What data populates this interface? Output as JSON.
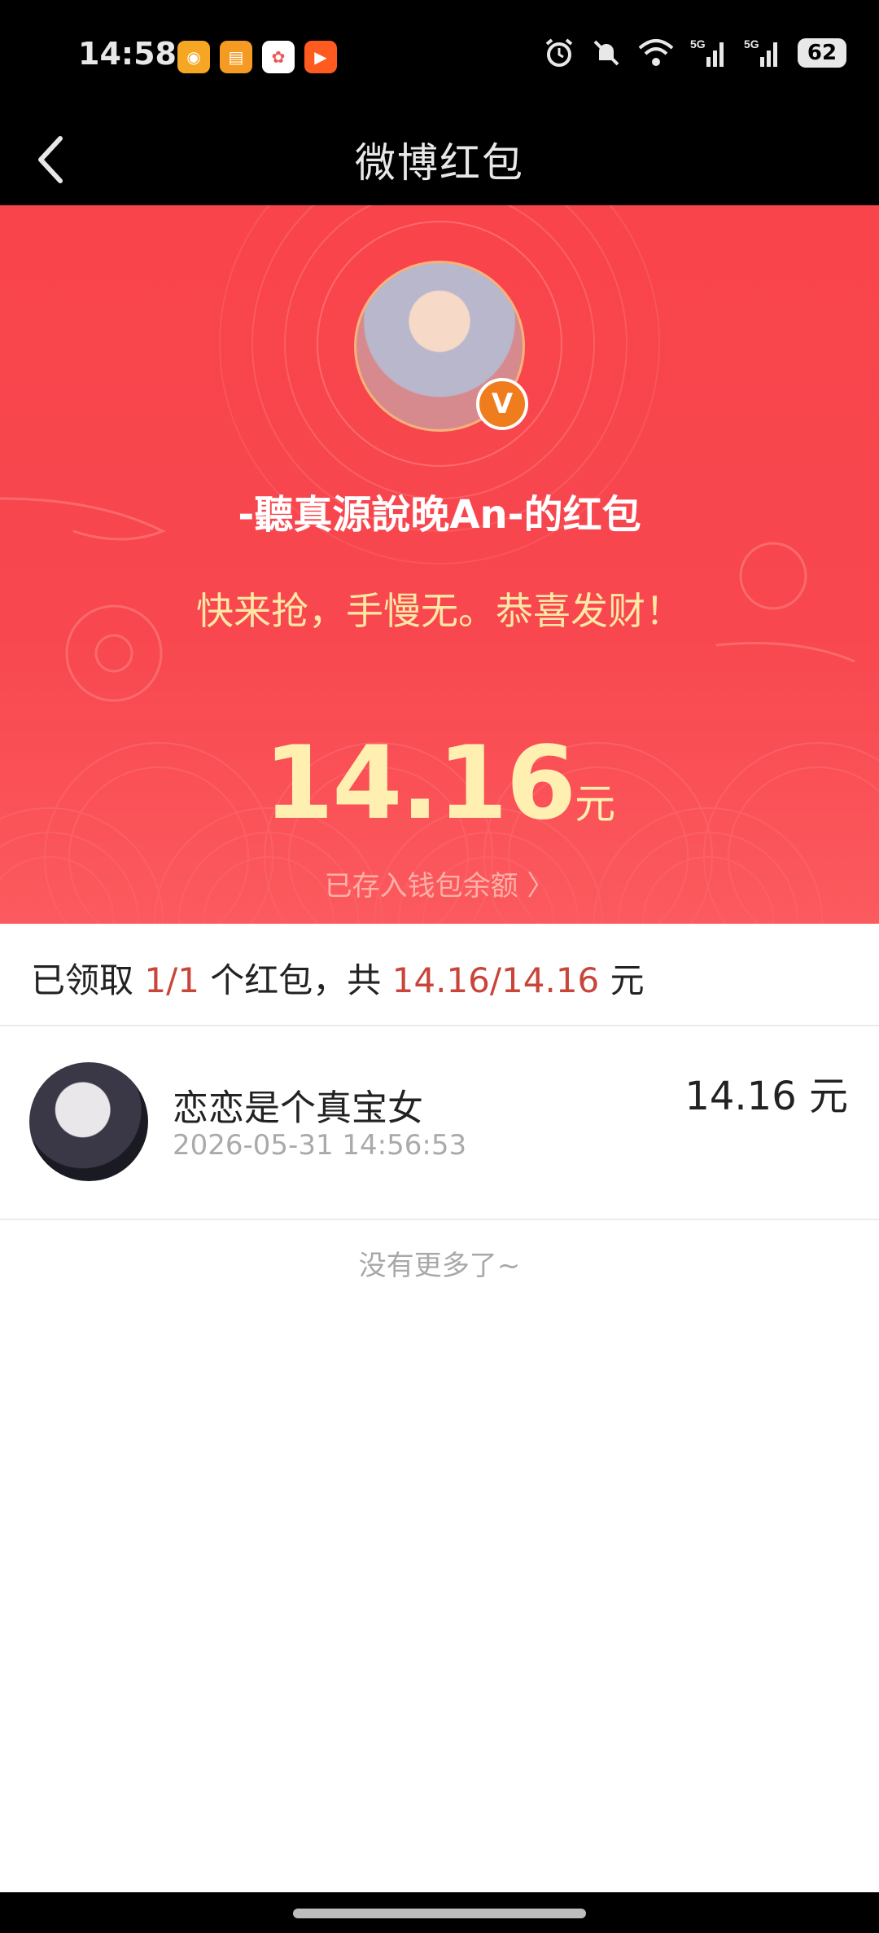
{
  "status_bar": {
    "time": "14:58",
    "battery": "62",
    "network_label": "5G",
    "icons": [
      "weibo-app-icon",
      "gift-app-icon",
      "photos-app-icon",
      "kuaishou-app-icon",
      "alarm-icon",
      "mute-icon",
      "wifi-icon",
      "signal-icon",
      "signal-icon",
      "battery-icon"
    ]
  },
  "header": {
    "title": "微博红包",
    "back_icon": "chevron-left-icon"
  },
  "hero": {
    "sender_name": "-聽真源說晚An-的红包",
    "greeting": "快来抢，手慢无。恭喜发财！",
    "amount": "14.16",
    "amount_unit": "元",
    "wallet_link": "已存入钱包余额 〉",
    "badge": "V",
    "colors": {
      "background": "#f9444b",
      "amount": "#fff0b2",
      "greeting": "#ffe8a6"
    }
  },
  "summary": {
    "prefix": "已领取 ",
    "count": "1/1",
    "middle": " 个红包，共 ",
    "total": "14.16/14.16",
    "suffix": " 元"
  },
  "records": [
    {
      "name": "恋恋是个真宝女",
      "time": "2026-05-31 14:56:53",
      "amount": "14.16 元"
    }
  ],
  "footer_text": "没有更多了~"
}
